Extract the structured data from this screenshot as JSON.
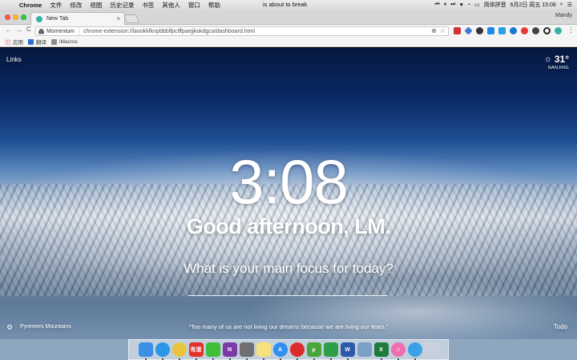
{
  "menubar": {
    "app": "Chrome",
    "menus": [
      "文件",
      "修改",
      "视图",
      "历史记录",
      "书签",
      "其他人",
      "窗口",
      "帮助"
    ],
    "center": "is about to break",
    "ime": "简体拼音",
    "datetime": "6月2日 周五  15:08"
  },
  "tab": {
    "title": "New Tab",
    "close": "×"
  },
  "profile": "Mandy",
  "toolbar": {
    "back": "←",
    "forward": "→",
    "reload": "C",
    "chip": "Momentum",
    "url": "chrome-extension://laookkfknpbbblfpciffpaejjkokdgca/dashboard.html"
  },
  "bookmarks": [
    {
      "label": "应用",
      "icon": "apps-icon"
    },
    {
      "label": "翻译",
      "icon": "translate-icon"
    },
    {
      "label": "iMacros",
      "icon": "folder-icon"
    }
  ],
  "momentum": {
    "links": "Links",
    "temperature": "31°",
    "city": "NANJING",
    "time": "3:08",
    "greeting": "Good afternoon, LM.",
    "focus_question": "What is your main focus for today?",
    "photo_location": "Pyrenees Mountains",
    "quote": "“Too many of us are not living our dreams because we are living our fears.”",
    "todo": "Todo"
  },
  "dock": [
    {
      "name": "finder",
      "color": "#3b8fe6",
      "label": ""
    },
    {
      "name": "safari",
      "color": "#2b95e8",
      "label": ""
    },
    {
      "name": "chrome",
      "color": "#e9c53c",
      "label": ""
    },
    {
      "name": "youdao",
      "color": "#e0312b",
      "label": "有道"
    },
    {
      "name": "wechat",
      "color": "#3fbf3a",
      "label": ""
    },
    {
      "name": "onenote",
      "color": "#7c3aa7",
      "label": "N"
    },
    {
      "name": "system-preferences",
      "color": "#6e6e73",
      "label": ""
    },
    {
      "name": "notes",
      "color": "#f6e27a",
      "label": ""
    },
    {
      "name": "app-store",
      "color": "#2f8fef",
      "label": "A"
    },
    {
      "name": "netease-music",
      "color": "#dd2a2a",
      "label": ""
    },
    {
      "name": "utorrent",
      "color": "#4aa63a",
      "label": "µ"
    },
    {
      "name": "evernote",
      "color": "#2f9e47",
      "label": ""
    },
    {
      "name": "word",
      "color": "#2b5aa8",
      "label": "W"
    },
    {
      "name": "preview",
      "color": "#7aa0c8",
      "label": ""
    },
    {
      "name": "excel",
      "color": "#1f7a3e",
      "label": "X"
    },
    {
      "name": "itunes",
      "color": "#f06db0",
      "label": "♫"
    },
    {
      "name": "qq",
      "color": "#3aa1e8",
      "label": ""
    },
    {
      "name": "trash",
      "color": "#c9d2dc",
      "label": ""
    }
  ]
}
